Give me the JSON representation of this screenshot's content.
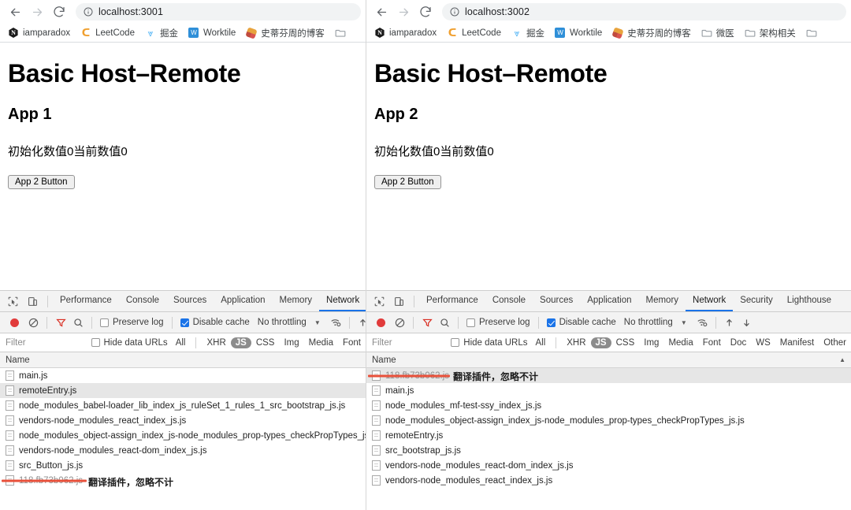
{
  "left": {
    "browser": {
      "back_icon": "back-arrow-icon",
      "forward_icon": "forward-arrow-icon",
      "reload_icon": "reload-icon",
      "info_icon": "site-info-icon",
      "url": "localhost:3001"
    },
    "bookmarks": [
      {
        "label": "iamparadox",
        "icon": "notion-hexagon-icon"
      },
      {
        "label": "LeetCode",
        "icon": "leetcode-icon"
      },
      {
        "label": "掘金",
        "icon": "juejin-icon"
      },
      {
        "label": "Worktile",
        "icon": "worktile-icon"
      },
      {
        "label": "史蒂芬周的博客",
        "icon": "blog-icon"
      },
      {
        "label": "",
        "icon": "folder-icon"
      }
    ],
    "page": {
      "title": "Basic Host–Remote",
      "app_heading": "App 1",
      "counter_text": "初始化数值0当前数值0",
      "button_label": "App 2 Button"
    },
    "devtools": {
      "inspect_icon": "inspect-element-icon",
      "device_icon": "device-toolbar-icon",
      "tabs": [
        {
          "label": "Performance",
          "active": false
        },
        {
          "label": "Console",
          "active": false
        },
        {
          "label": "Sources",
          "active": false
        },
        {
          "label": "Application",
          "active": false
        },
        {
          "label": "Memory",
          "active": false
        },
        {
          "label": "Network",
          "active": true
        }
      ],
      "toolbar": {
        "record_icon": "record-button-icon",
        "clear_icon": "clear-network-log-icon",
        "filter_icon": "filter-icon",
        "search_icon": "search-icon",
        "preserve_log_label": "Preserve log",
        "preserve_log_checked": false,
        "disable_cache_label": "Disable cache",
        "disable_cache_checked": true,
        "throttling_label": "No throttling",
        "caret_icon": "chevron-down-icon",
        "wifi_icon": "network-conditions-icon",
        "import_icon": "import-har-icon"
      },
      "filterbar": {
        "filter_placeholder": "Filter",
        "hide_data_urls_label": "Hide data URLs",
        "hide_data_urls_checked": false,
        "types": [
          "All",
          "XHR",
          "JS",
          "CSS",
          "Img",
          "Media",
          "Font"
        ],
        "selected_type": "JS"
      },
      "column_header": "Name",
      "files": [
        {
          "name": "main.js",
          "highlight": false,
          "struck": false
        },
        {
          "name": "remoteEntry.js",
          "highlight": true,
          "struck": false
        },
        {
          "name": "node_modules_babel-loader_lib_index_js_ruleSet_1_rules_1_src_bootstrap_js.js",
          "highlight": false,
          "struck": false
        },
        {
          "name": "vendors-node_modules_react_index_js.js",
          "highlight": false,
          "struck": false
        },
        {
          "name": "node_modules_object-assign_index_js-node_modules_prop-types_checkPropTypes_js.js",
          "highlight": false,
          "struck": false
        },
        {
          "name": "vendors-node_modules_react-dom_index_js.js",
          "highlight": false,
          "struck": false
        },
        {
          "name": "src_Button_js.js",
          "highlight": false,
          "struck": false
        },
        {
          "name": "118.fb73b062.js",
          "highlight": false,
          "struck": true
        }
      ],
      "annotation": "翻译插件，忽略不计"
    }
  },
  "right": {
    "browser": {
      "back_icon": "back-arrow-icon",
      "forward_icon": "forward-arrow-icon",
      "reload_icon": "reload-icon",
      "info_icon": "site-info-icon",
      "url": "localhost:3002"
    },
    "bookmarks": [
      {
        "label": "iamparadox",
        "icon": "notion-hexagon-icon"
      },
      {
        "label": "LeetCode",
        "icon": "leetcode-icon"
      },
      {
        "label": "掘金",
        "icon": "juejin-icon"
      },
      {
        "label": "Worktile",
        "icon": "worktile-icon"
      },
      {
        "label": "史蒂芬周的博客",
        "icon": "blog-icon"
      },
      {
        "label": "微医",
        "icon": "folder-icon"
      },
      {
        "label": "架构相关",
        "icon": "folder-icon"
      },
      {
        "label": "",
        "icon": "folder-icon"
      }
    ],
    "page": {
      "title": "Basic Host–Remote",
      "app_heading": "App 2",
      "counter_text": "初始化数值0当前数值0",
      "button_label": "App 2 Button"
    },
    "devtools": {
      "inspect_icon": "inspect-element-icon",
      "device_icon": "device-toolbar-icon",
      "tabs": [
        {
          "label": "Performance",
          "active": false
        },
        {
          "label": "Console",
          "active": false
        },
        {
          "label": "Sources",
          "active": false
        },
        {
          "label": "Application",
          "active": false
        },
        {
          "label": "Memory",
          "active": false
        },
        {
          "label": "Network",
          "active": true
        },
        {
          "label": "Security",
          "active": false
        },
        {
          "label": "Lighthouse",
          "active": false
        }
      ],
      "toolbar": {
        "record_icon": "record-button-icon",
        "clear_icon": "clear-network-log-icon",
        "filter_icon": "filter-icon",
        "search_icon": "search-icon",
        "preserve_log_label": "Preserve log",
        "preserve_log_checked": false,
        "disable_cache_label": "Disable cache",
        "disable_cache_checked": true,
        "throttling_label": "No throttling",
        "caret_icon": "chevron-down-icon",
        "wifi_icon": "network-conditions-icon",
        "import_icon": "import-har-icon",
        "export_icon": "export-har-icon"
      },
      "filterbar": {
        "filter_placeholder": "Filter",
        "hide_data_urls_label": "Hide data URLs",
        "hide_data_urls_checked": false,
        "types": [
          "All",
          "XHR",
          "JS",
          "CSS",
          "Img",
          "Media",
          "Font",
          "Doc",
          "WS",
          "Manifest",
          "Other"
        ],
        "selected_type": "JS"
      },
      "column_header": "Name",
      "sort_icon": "sort-ascending-icon",
      "files": [
        {
          "name": "118.fb73b062.js",
          "highlight": true,
          "struck": true
        },
        {
          "name": "main.js",
          "highlight": false,
          "struck": false
        },
        {
          "name": "node_modules_mf-test-ssy_index_js.js",
          "highlight": false,
          "struck": false
        },
        {
          "name": "node_modules_object-assign_index_js-node_modules_prop-types_checkPropTypes_js.js",
          "highlight": false,
          "struck": false
        },
        {
          "name": "remoteEntry.js",
          "highlight": false,
          "struck": false
        },
        {
          "name": "src_bootstrap_js.js",
          "highlight": false,
          "struck": false
        },
        {
          "name": "vendors-node_modules_react-dom_index_js.js",
          "highlight": false,
          "struck": false
        },
        {
          "name": "vendors-node_modules_react_index_js.js",
          "highlight": false,
          "struck": false
        }
      ],
      "annotation": "翻译插件，忽略不计"
    }
  }
}
